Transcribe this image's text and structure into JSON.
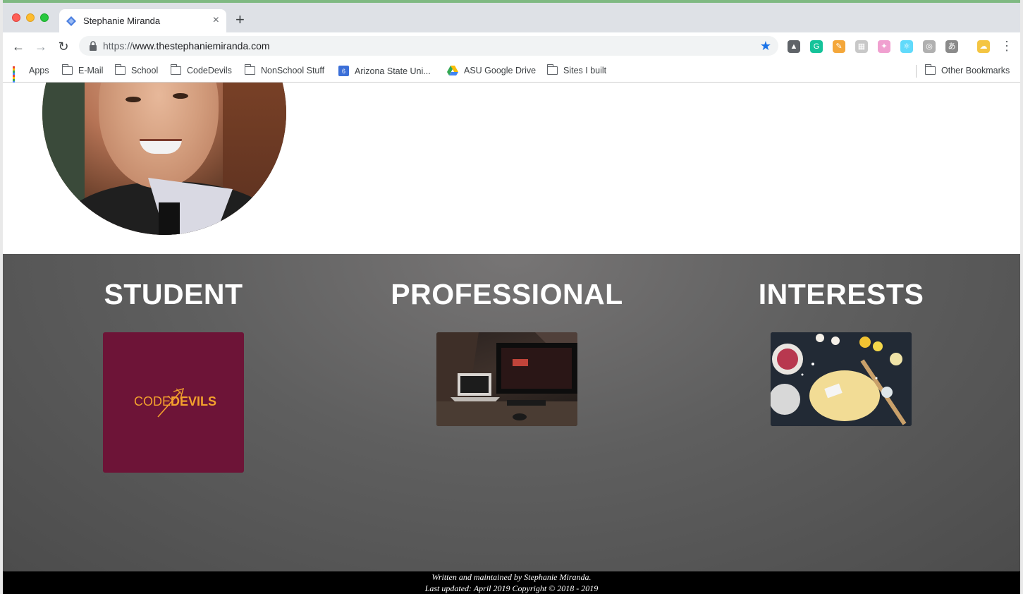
{
  "browser": {
    "tab": {
      "title": "Stephanie Miranda",
      "close_label": "×"
    },
    "new_tab_label": "+",
    "nav": {
      "back_label": "←",
      "forward_label": "→",
      "reload_label": "↻"
    },
    "address": {
      "scheme": "https://",
      "host": "www.thestephaniemiranda.com"
    },
    "star_label": "★",
    "menu_label": "⋮",
    "extensions": [
      {
        "name": "google-drive-extension-icon",
        "color": "#5f6368",
        "glyph": "▲"
      },
      {
        "name": "grammarly-extension-icon",
        "color": "#15c39a",
        "glyph": "G"
      },
      {
        "name": "pencil-extension-icon",
        "color": "#f4a73a",
        "glyph": "✎"
      },
      {
        "name": "grid-extension-icon",
        "color": "#c8c8c8",
        "glyph": "▦"
      },
      {
        "name": "sparkle-extension-icon",
        "color": "#f0a0d0",
        "glyph": "✦"
      },
      {
        "name": "react-devtools-extension-icon",
        "color": "#61dafb",
        "glyph": "⚛"
      },
      {
        "name": "circle-extension-icon",
        "color": "#b0b0b0",
        "glyph": "◎"
      },
      {
        "name": "translate-extension-icon",
        "color": "#8a8a8a",
        "glyph": "あ"
      },
      {
        "name": "weather-extension-icon",
        "color": "#f4c542",
        "glyph": "☁"
      }
    ],
    "bookmarks": [
      {
        "label": "Apps",
        "icon": "apps-grid-icon"
      },
      {
        "label": "E-Mail",
        "icon": "folder-icon"
      },
      {
        "label": "School",
        "icon": "folder-icon"
      },
      {
        "label": "CodeDevils",
        "icon": "folder-icon"
      },
      {
        "label": "NonSchool Stuff",
        "icon": "folder-icon"
      },
      {
        "label": "Arizona State Uni...",
        "icon": "calendar-icon"
      },
      {
        "label": "ASU Google Drive",
        "icon": "google-drive-icon"
      },
      {
        "label": "Sites I built",
        "icon": "folder-icon"
      },
      {
        "label": "Other Bookmarks",
        "icon": "folder-icon"
      }
    ],
    "calendar_day": "6"
  },
  "page": {
    "sections": [
      {
        "heading": "STUDENT",
        "image": "codedevils-logo"
      },
      {
        "heading": "PROFESSIONAL",
        "image": "desk-computer-photo"
      },
      {
        "heading": "INTERESTS",
        "image": "cooking-photo"
      }
    ],
    "student_logo": {
      "code": "CODE",
      "devils": "DEVILS"
    },
    "footer": {
      "line1": "Written and maintained by Stephanie Miranda.",
      "line2": "Last updated: April 2019 Copyright © 2018 - 2019"
    }
  },
  "colors": {
    "asu_maroon": "#6d1437",
    "asu_gold": "#f3a12d",
    "star_blue": "#1a73e8"
  }
}
